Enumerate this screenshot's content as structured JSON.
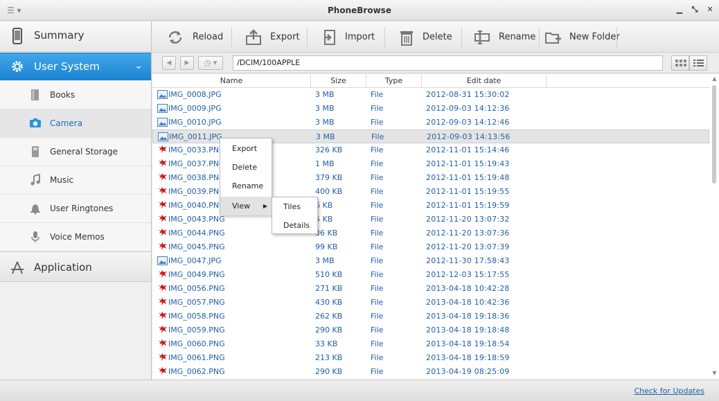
{
  "window": {
    "title": "PhoneBrowse",
    "menu_icon": "menu-icon",
    "controls": [
      "minimize",
      "restore",
      "close"
    ]
  },
  "sidebar": {
    "summary_label": "Summary",
    "user_system_label": "User System",
    "items": [
      {
        "label": "Books",
        "icon": "book-icon"
      },
      {
        "label": "Camera",
        "icon": "camera-icon",
        "active": true
      },
      {
        "label": "General Storage",
        "icon": "storage-icon"
      },
      {
        "label": "Music",
        "icon": "music-icon"
      },
      {
        "label": "User Ringtones",
        "icon": "bell-icon"
      },
      {
        "label": "Voice Memos",
        "icon": "microphone-icon"
      }
    ],
    "application_label": "Application"
  },
  "toolbar": {
    "reload_label": "Reload",
    "export_label": "Export",
    "import_label": "Import",
    "delete_label": "Delete",
    "rename_label": "Rename",
    "new_folder_label": "New Folder"
  },
  "nav": {
    "path": "/DCIM/100APPLE"
  },
  "table": {
    "headers": {
      "name": "Name",
      "size": "Size",
      "type": "Type",
      "date": "Edit date"
    },
    "rows": [
      {
        "name": "IMG_0008.JPG",
        "size": "3 MB",
        "type": "File",
        "date": "2012-08-31 15:30:02",
        "kind": "jpg"
      },
      {
        "name": "IMG_0009.JPG",
        "size": "3 MB",
        "type": "File",
        "date": "2012-09-03 14:12:36",
        "kind": "jpg"
      },
      {
        "name": "IMG_0010.JPG",
        "size": "3 MB",
        "type": "File",
        "date": "2012-09-03 14:12:46",
        "kind": "jpg"
      },
      {
        "name": "IMG_0011.JPG",
        "size": "3 MB",
        "type": "File",
        "date": "2012-09-03 14:13:56",
        "kind": "jpg",
        "selected": true
      },
      {
        "name": "IMG_0033.PNG",
        "size": "326 KB",
        "type": "File",
        "date": "2012-11-01 15:14:46",
        "kind": "png"
      },
      {
        "name": "IMG_0037.PNG",
        "size": "1 MB",
        "type": "File",
        "date": "2012-11-01 15:19:43",
        "kind": "png"
      },
      {
        "name": "IMG_0038.PNG",
        "size": "379 KB",
        "type": "File",
        "date": "2012-11-01 15:19:48",
        "kind": "png"
      },
      {
        "name": "IMG_0039.PNG",
        "size": "400 KB",
        "type": "File",
        "date": "2012-11-01 15:19:55",
        "kind": "png"
      },
      {
        "name": "IMG_0040.PNG",
        "size": "6 KB",
        "type": "File",
        "date": "2012-11-01 15:19:59",
        "kind": "png"
      },
      {
        "name": "IMG_0043.PNG",
        "size": "5 KB",
        "type": "File",
        "date": "2012-11-20 13:07:32",
        "kind": "png"
      },
      {
        "name": "IMG_0044.PNG",
        "size": "36 KB",
        "type": "File",
        "date": "2012-11-20 13:07:36",
        "kind": "png"
      },
      {
        "name": "IMG_0045.PNG",
        "size": "99 KB",
        "type": "File",
        "date": "2012-11-20 13:07:39",
        "kind": "png"
      },
      {
        "name": "IMG_0047.JPG",
        "size": "3 MB",
        "type": "File",
        "date": "2012-11-30 17:58:43",
        "kind": "jpg"
      },
      {
        "name": "IMG_0049.PNG",
        "size": "510 KB",
        "type": "File",
        "date": "2012-12-03 15:17:55",
        "kind": "png"
      },
      {
        "name": "IMG_0056.PNG",
        "size": "271 KB",
        "type": "File",
        "date": "2013-04-18 10:42:28",
        "kind": "png"
      },
      {
        "name": "IMG_0057.PNG",
        "size": "430 KB",
        "type": "File",
        "date": "2013-04-18 10:42:36",
        "kind": "png"
      },
      {
        "name": "IMG_0058.PNG",
        "size": "262 KB",
        "type": "File",
        "date": "2013-04-18 19:18:36",
        "kind": "png"
      },
      {
        "name": "IMG_0059.PNG",
        "size": "290 KB",
        "type": "File",
        "date": "2013-04-18 19:18:48",
        "kind": "png"
      },
      {
        "name": "IMG_0060.PNG",
        "size": "33 KB",
        "type": "File",
        "date": "2013-04-18 19:18:54",
        "kind": "png"
      },
      {
        "name": "IMG_0061.PNG",
        "size": "213 KB",
        "type": "File",
        "date": "2013-04-18 19:18:59",
        "kind": "png"
      },
      {
        "name": "IMG_0062.PNG",
        "size": "290 KB",
        "type": "File",
        "date": "2013-04-19 08:25:09",
        "kind": "png"
      }
    ]
  },
  "context_menu": {
    "items": [
      "Export",
      "Delete",
      "Rename",
      "View"
    ],
    "view_submenu": [
      "Tiles",
      "Details"
    ]
  },
  "status": {
    "update_link": "Check for Updates"
  },
  "colors": {
    "accent": "#2a93dd",
    "link": "#1f5fa8",
    "png_icon": "#d01818"
  }
}
